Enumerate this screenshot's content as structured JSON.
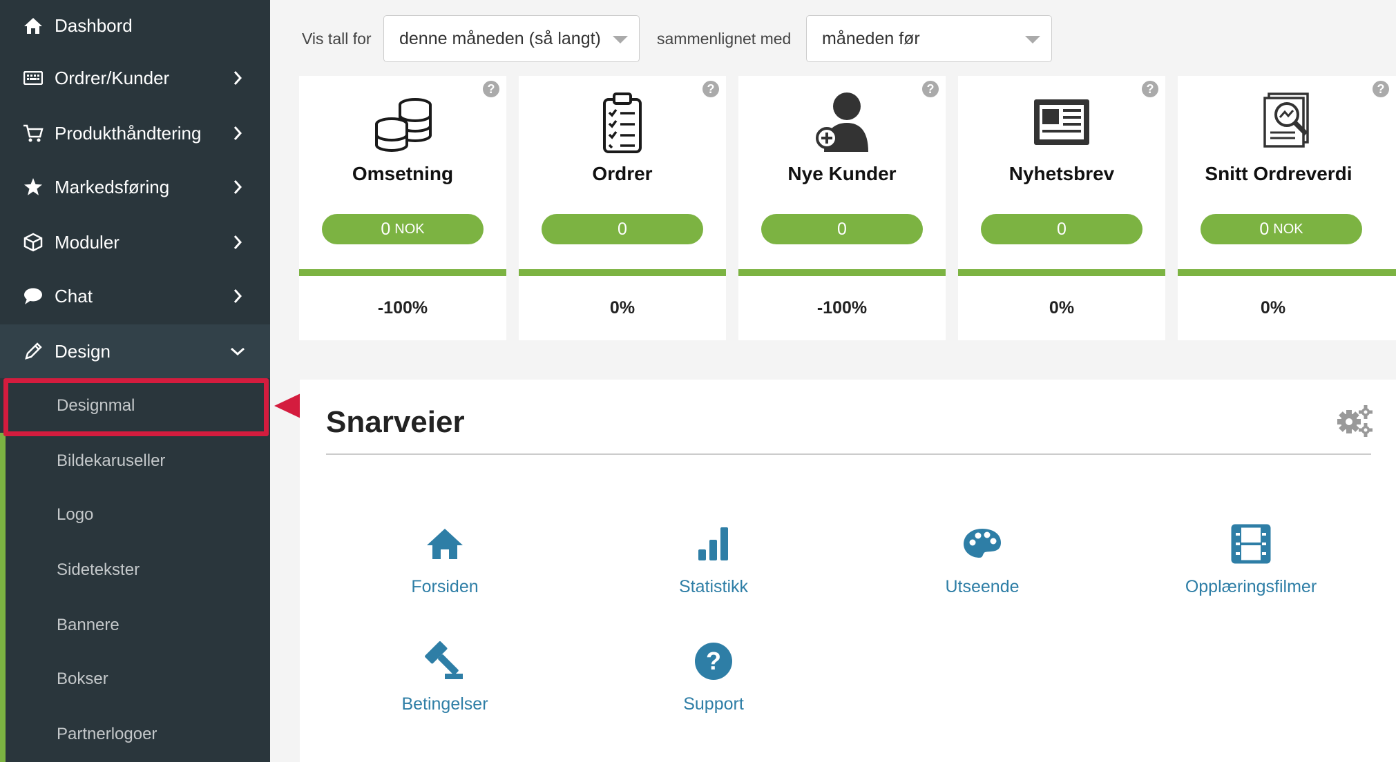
{
  "sidebar": {
    "items": [
      {
        "label": "Dashbord",
        "icon": "home-icon"
      },
      {
        "label": "Ordrer/Kunder",
        "icon": "keyboard-icon"
      },
      {
        "label": "Produkthåndtering",
        "icon": "cart-icon"
      },
      {
        "label": "Markedsføring",
        "icon": "star-icon"
      },
      {
        "label": "Moduler",
        "icon": "cube-icon"
      },
      {
        "label": "Chat",
        "icon": "chat-bubble-icon"
      },
      {
        "label": "Design",
        "icon": "pencil-icon"
      }
    ],
    "submenu": [
      "Designmal",
      "Bildekaruseller",
      "Logo",
      "Sidetekster",
      "Bannere",
      "Bokser",
      "Partnerlogoer"
    ]
  },
  "filter": {
    "show_label": "Vis tall for",
    "period_value": "denne måneden (så langt)",
    "compare_label": "sammenlignet med",
    "compare_value": "måneden før"
  },
  "cards": [
    {
      "title": "Omsetning",
      "value": "0",
      "unit": "NOK",
      "change": "-100%",
      "icon": "coins-icon"
    },
    {
      "title": "Ordrer",
      "value": "0",
      "unit": "",
      "change": "0%",
      "icon": "clipboard-icon"
    },
    {
      "title": "Nye Kunder",
      "value": "0",
      "unit": "",
      "change": "-100%",
      "icon": "add-user-icon"
    },
    {
      "title": "Nyhetsbrev",
      "value": "0",
      "unit": "",
      "change": "0%",
      "icon": "newspaper-icon"
    },
    {
      "title": "Snitt Ordreverdi",
      "value": "0",
      "unit": "NOK",
      "change": "0%",
      "icon": "report-magnifier-icon"
    }
  ],
  "help_glyph": "?",
  "shortcuts": {
    "title": "Snarveier",
    "items": [
      {
        "label": "Forsiden",
        "icon": "home-icon"
      },
      {
        "label": "Statistikk",
        "icon": "bar-chart-icon"
      },
      {
        "label": "Utseende",
        "icon": "palette-icon"
      },
      {
        "label": "Opplæringsfilmer",
        "icon": "film-icon"
      },
      {
        "label": "Betingelser",
        "icon": "gavel-icon"
      },
      {
        "label": "Support",
        "icon": "question-circle-icon"
      }
    ]
  },
  "colors": {
    "sidebar_bg": "#2a363c",
    "accent_green": "#7cb342",
    "link_blue": "#2e7ea6",
    "highlight_red": "#d41c3e"
  }
}
